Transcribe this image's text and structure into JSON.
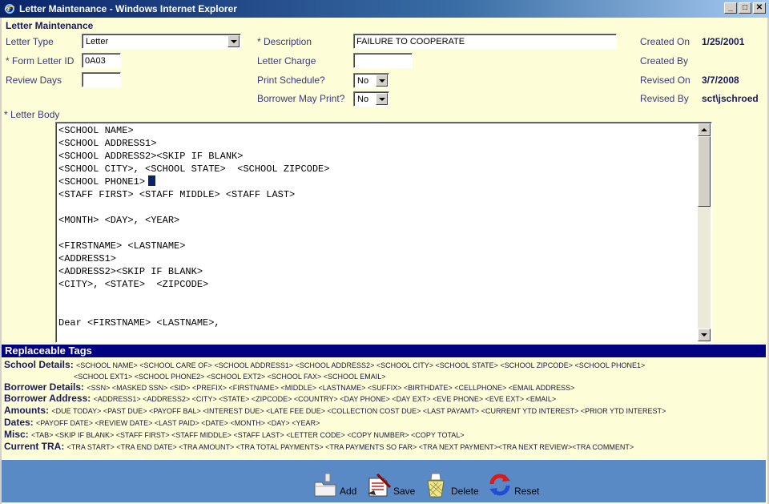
{
  "window": {
    "title": "Letter Maintenance - Windows Internet Explorer",
    "buttons": {
      "minimize": "_",
      "maximize": "□",
      "close": "✕"
    }
  },
  "page": {
    "heading": "Letter Maintenance"
  },
  "form": {
    "letter_type": {
      "label": "Letter Type",
      "value": "Letter"
    },
    "form_letter_id": {
      "label": "* Form Letter ID",
      "value": "0A03"
    },
    "review_days": {
      "label": "Review Days",
      "value": ""
    },
    "description": {
      "label": "* Description",
      "value": "FAILURE TO COOPERATE"
    },
    "letter_charge": {
      "label": "Letter Charge",
      "value": ""
    },
    "print_schedule": {
      "label": "Print Schedule?",
      "value": "No"
    },
    "borrower_may_print": {
      "label": "Borrower May Print?",
      "value": "No"
    },
    "created_on": {
      "label": "Created On",
      "value": "1/25/2001"
    },
    "created_by": {
      "label": "Created By",
      "value": ""
    },
    "revised_on": {
      "label": "Revised On",
      "value": "3/7/2008"
    },
    "revised_by": {
      "label": "Revised By",
      "value": "sct\\jschroed"
    }
  },
  "letter_body": {
    "label": "* Letter Body",
    "lines_before_cursor": "<SCHOOL NAME>\n<SCHOOL ADDRESS1>\n<SCHOOL ADDRESS2><SKIP IF BLANK>\n<SCHOOL CITY>, <SCHOOL STATE>  <SCHOOL ZIPCODE>\n<SCHOOL PHONE1>",
    "lines_after_cursor": "<STAFF FIRST> <STAFF MIDDLE> <STAFF LAST>\n\n<MONTH> <DAY>, <YEAR>\n\n<FIRSTNAME> <LASTNAME>\n<ADDRESS1>\n<ADDRESS2><SKIP IF BLANK>\n<CITY>, <STATE>  <ZIPCODE>\n\n\nDear <FIRSTNAME> <LASTNAME>,"
  },
  "replaceable_tags": {
    "header": "Replaceable Tags",
    "groups": [
      {
        "label": "School Details:",
        "tags": "<SCHOOL NAME> <SCHOOL CARE OF> <SCHOOL ADDRESS1> <SCHOOL ADDRESS2> <SCHOOL CITY> <SCHOOL STATE> <SCHOOL ZIPCODE> <SCHOOL PHONE1>",
        "tags2": "<SCHOOL EXT1> <SCHOOL PHONE2> <SCHOOL EXT2> <SCHOOL FAX> <SCHOOL EMAIL>"
      },
      {
        "label": "Borrower Details:",
        "tags": "<SSN> <MASKED SSN> <SID> <PREFIX> <FIRSTNAME> <MIDDLE> <LASTNAME> <SUFFIX> <BIRTHDATE> <CELLPHONE> <EMAIL ADDRESS>"
      },
      {
        "label": "Borrower Address:",
        "tags": "<ADDRESS1> <ADDRESS2> <CITY> <STATE> <ZIPCODE> <COUNTRY> <DAY PHONE> <DAY EXT> <EVE PHONE> <EVE EXT> <EMAIL>"
      },
      {
        "label": "Amounts:",
        "tags": "<DUE TODAY> <PAST DUE> <PAYOFF BAL> <INTEREST DUE> <LATE FEE DUE> <COLLECTION COST DUE> <LAST PAYAMT> <CURRENT YTD INTEREST> <PRIOR YTD INTEREST>"
      },
      {
        "label": "Dates:",
        "tags": "<PAYOFF DATE> <REVIEW DATE> <LAST PAID> <DATE> <MONTH> <DAY> <YEAR>"
      },
      {
        "label": "Misc:",
        "tags": "<TAB> <SKIP IF BLANK> <STAFF FIRST> <STAFF MIDDLE> <STAFF LAST> <LETTER CODE> <COPY NUMBER> <COPY TOTAL>"
      },
      {
        "label": "Current TRA:",
        "tags": "<TRA START> <TRA END DATE> <TRA AMOUNT> <TRA TOTAL PAYMENTS> <TRA PAYMENTS SO FAR> <TRA NEXT PAYMENT><TRA NEXT REVIEW><TRA COMMENT>"
      }
    ]
  },
  "actions": {
    "add": {
      "label": "Add",
      "icon": "add-folder-icon"
    },
    "save": {
      "label": "Save",
      "icon": "save-document-icon"
    },
    "delete": {
      "label": "Delete",
      "icon": "wastebasket-icon"
    },
    "reset": {
      "label": "Reset",
      "icon": "circular-arrows-icon"
    }
  },
  "colors": {
    "background": "#fdfdd8",
    "tags_header": "#000080",
    "bottom_bar": "#5a8ac6"
  }
}
